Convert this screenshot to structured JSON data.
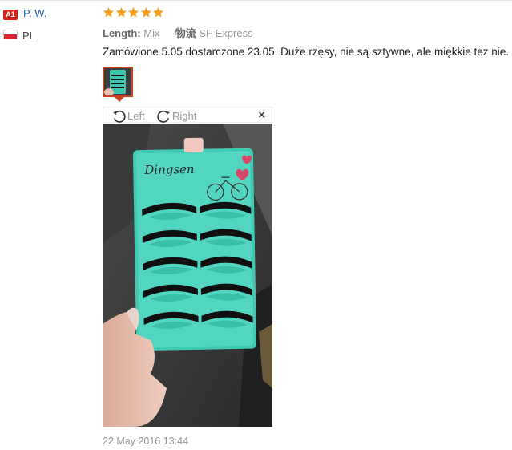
{
  "reviewer": {
    "badge": "A1",
    "name": "P. W.",
    "country": "PL"
  },
  "rating": {
    "stars": 5,
    "max": 5,
    "color": "#f3a01c"
  },
  "attributes": [
    {
      "key": "Length:",
      "value": "Mix"
    },
    {
      "key": "物流",
      "value": "SF Express"
    }
  ],
  "review_text": "Zamówione 5.05 dostarczone 23.05. Duże rzęsy, nie są sztywne, ale miękkie tez nie.",
  "viewer": {
    "rotate_left": "Left",
    "rotate_right": "Right",
    "close": "×",
    "brand": "Dingsen"
  },
  "date": "22 May 2016 13:44"
}
